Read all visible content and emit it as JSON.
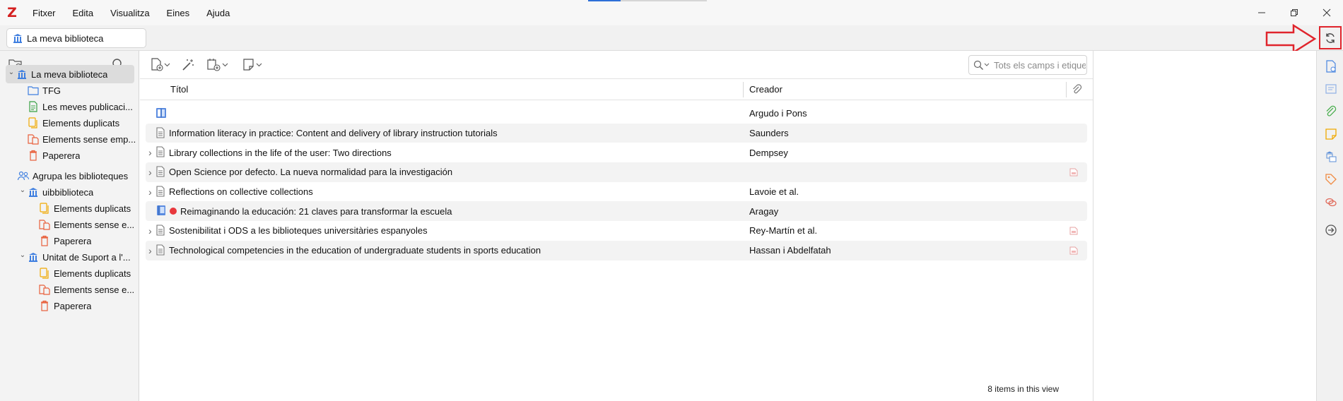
{
  "app": {
    "logo": "Z",
    "menu": [
      "Fitxer",
      "Edita",
      "Visualitza",
      "Eines",
      "Ajuda"
    ]
  },
  "tab": {
    "label": "La meva biblioteca",
    "icon": "library-icon"
  },
  "colors": {
    "accent": "#2e6fd8",
    "logo": "#d42020",
    "annotation": "#e0242c",
    "dot_red": "#e8383d"
  },
  "collections": [
    {
      "label": "La meva biblioteca",
      "icon": "library-icon",
      "level": 0,
      "twisty": "open",
      "selected": true
    },
    {
      "label": "TFG",
      "icon": "folder-icon",
      "level": 1
    },
    {
      "label": "Les meves publicaci...",
      "icon": "publications-icon",
      "level": 1
    },
    {
      "label": "Elements duplicats",
      "icon": "duplicates-icon",
      "level": 1
    },
    {
      "label": "Elements sense emp...",
      "icon": "unfiled-icon",
      "level": 1
    },
    {
      "label": "Paperera",
      "icon": "trash-icon",
      "level": 1
    },
    {
      "label": "Agrupa les biblioteques",
      "icon": "groups-icon",
      "level": 0,
      "header": true
    },
    {
      "label": "uibbiblioteca",
      "icon": "library-icon",
      "level": 1,
      "twisty": "open"
    },
    {
      "label": "Elements duplicats",
      "icon": "duplicates-icon",
      "level": 2
    },
    {
      "label": "Elements sense e...",
      "icon": "unfiled-icon",
      "level": 2
    },
    {
      "label": "Paperera",
      "icon": "trash-icon",
      "level": 2
    },
    {
      "label": "Unitat de Suport a l'...",
      "icon": "library-icon",
      "level": 1,
      "twisty": "open"
    },
    {
      "label": "Elements duplicats",
      "icon": "duplicates-icon",
      "level": 2
    },
    {
      "label": "Elements sense e...",
      "icon": "unfiled-icon",
      "level": 2
    },
    {
      "label": "Paperera",
      "icon": "trash-icon",
      "level": 2
    }
  ],
  "search": {
    "placeholder": "Tots els camps i etiquetes",
    "value": ""
  },
  "columns": {
    "title": "Títol",
    "creator": "Creador"
  },
  "items": [
    {
      "title": "",
      "creator": "Argudo i Pons",
      "icon": "book-section-icon",
      "twisty": false,
      "pdf": false,
      "dot": false
    },
    {
      "title": "Information literacy in practice: Content and delivery of library instruction tutorials",
      "creator": "Saunders",
      "icon": "document-icon",
      "twisty": false,
      "pdf": false,
      "dot": false
    },
    {
      "title": "Library collections in the life of the user: Two directions",
      "creator": "Dempsey",
      "icon": "document-icon",
      "twisty": true,
      "pdf": false,
      "dot": false
    },
    {
      "title": "Open Science por defecto. La nueva normalidad para la investigación",
      "creator": "",
      "icon": "document-icon",
      "twisty": true,
      "pdf": true,
      "dot": false
    },
    {
      "title": "Reflections on collective collections",
      "creator": "Lavoie et al.",
      "icon": "document-icon",
      "twisty": true,
      "pdf": false,
      "dot": false
    },
    {
      "title": "Reimaginando la educación: 21 claves para transformar la escuela",
      "creator": "Aragay",
      "icon": "book-icon",
      "twisty": false,
      "pdf": false,
      "dot": true
    },
    {
      "title": "Sostenibilitat i ODS a les biblioteques universitàries espanyoles",
      "creator": "Rey-Martín et al.",
      "icon": "document-icon",
      "twisty": true,
      "pdf": true,
      "dot": false
    },
    {
      "title": "Technological competencies in the education of undergraduate students in sports education",
      "creator": "Hassan i Abdelfatah",
      "icon": "document-icon",
      "twisty": true,
      "pdf": true,
      "dot": false
    }
  ],
  "status": {
    "count": "8 items in this view"
  },
  "sidebar_icons": [
    "info-icon",
    "abstract-icon",
    "attachments-icon",
    "notes-icon",
    "libraries-collections-icon",
    "tags-icon",
    "related-icon",
    "locate-icon"
  ]
}
